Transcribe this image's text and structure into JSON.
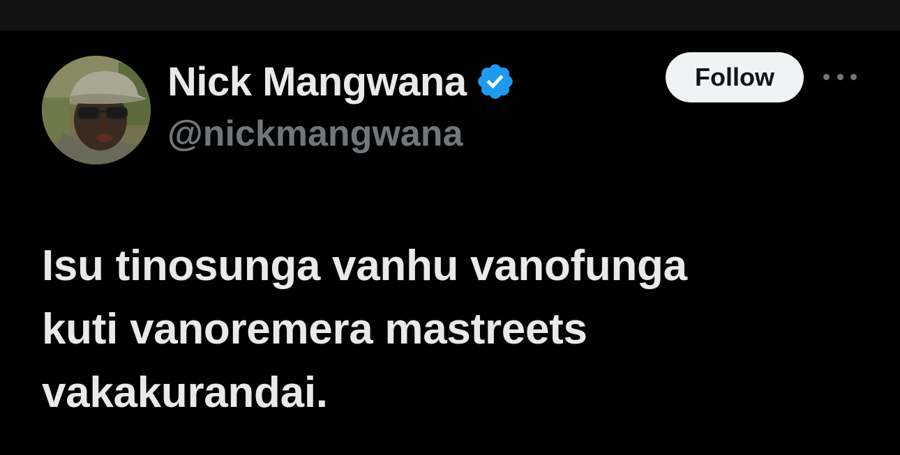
{
  "author": {
    "display_name": "Nick Mangwana",
    "handle": "@nickmangwana",
    "verified": true,
    "avatar_icon": "profile-photo"
  },
  "actions": {
    "follow_label": "Follow",
    "more_icon": "more-horizontal-icon"
  },
  "tweet": {
    "text": "Isu tinosunga vanhu vanofunga\nkuti vanoremera mastreets\nvakakurandai."
  },
  "colors": {
    "background": "#000000",
    "top_bar": "#131313",
    "primary_text": "#e7e9ea",
    "secondary_text": "#71767b",
    "verified_blue": "#1d9bf0",
    "follow_button_bg": "#eff3f4",
    "follow_button_text": "#0f1419"
  }
}
